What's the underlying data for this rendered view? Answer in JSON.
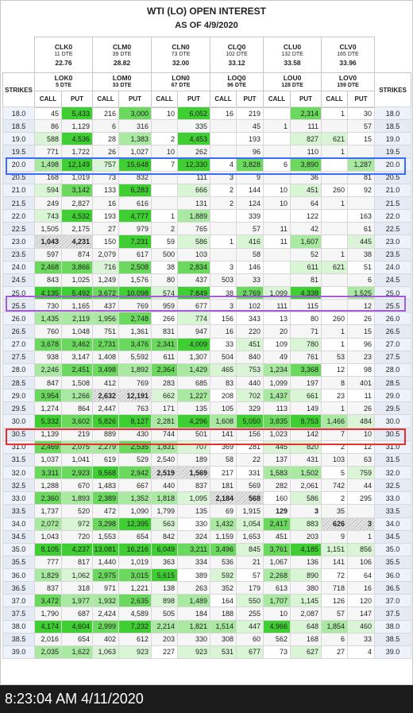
{
  "title": "WTI (LO) OPEN INTEREST",
  "subtitle": "AS OF 4/9/2020",
  "strikes_label": "STRIKES",
  "call_label": "CALL",
  "put_label": "PUT",
  "futures": [
    {
      "name": "CLK0",
      "dte": "11 DTE",
      "price": "22.76"
    },
    {
      "name": "CLM0",
      "dte": "39 DTE",
      "price": "28.82"
    },
    {
      "name": "CLN0",
      "dte": "73 DTE",
      "price": "32.00"
    },
    {
      "name": "CLQ0",
      "dte": "102 DTE",
      "price": "33.12"
    },
    {
      "name": "CLU0",
      "dte": "132 DTE",
      "price": "33.58"
    },
    {
      "name": "CLV0",
      "dte": "165 DTE",
      "price": "33.96"
    }
  ],
  "options": [
    {
      "name": "LOK0",
      "dte": "5 DTE"
    },
    {
      "name": "LOM0",
      "dte": "33 DTE"
    },
    {
      "name": "LON0",
      "dte": "67 DTE"
    },
    {
      "name": "LOQ0",
      "dte": "96 DTE"
    },
    {
      "name": "LOU0",
      "dte": "128 DTE"
    },
    {
      "name": "LOV0",
      "dte": "159 DTE"
    }
  ],
  "rows": [
    [
      "18.0",
      "45",
      "5,433",
      "216",
      "3,000",
      "10",
      "6,052",
      "16",
      "219",
      "",
      "2,314",
      "1",
      "30"
    ],
    [
      "18.5",
      "86",
      "1,129",
      "6",
      "316",
      "",
      "335",
      "",
      "45",
      "1",
      "111",
      "",
      "57"
    ],
    [
      "19.0",
      "588",
      "4,536",
      "28",
      "1,383",
      "2",
      "4,453",
      "",
      "193",
      "",
      "827",
      "621",
      "15"
    ],
    [
      "19.5",
      "771",
      "1,722",
      "26",
      "1,027",
      "10",
      "262",
      "",
      "96",
      "",
      "110",
      "1",
      ""
    ],
    [
      "20.0",
      "1,498",
      "12,149",
      "757",
      "15,648",
      "7",
      "12,330",
      "4",
      "3,828",
      "6",
      "3,890",
      "",
      "1,287"
    ],
    [
      "20.5",
      "168",
      "1,019",
      "73",
      "832",
      "",
      "111",
      "3",
      "9",
      "",
      "36",
      "",
      "81"
    ],
    [
      "21.0",
      "594",
      "3,142",
      "133",
      "6,283",
      "",
      "666",
      "2",
      "144",
      "10",
      "451",
      "260",
      "92"
    ],
    [
      "21.5",
      "249",
      "2,827",
      "16",
      "616",
      "",
      "131",
      "2",
      "124",
      "10",
      "64",
      "1",
      ""
    ],
    [
      "22.0",
      "743",
      "4,532",
      "193",
      "4,777",
      "1",
      "1,889",
      "",
      "339",
      "",
      "122",
      "",
      "163"
    ],
    [
      "22.5",
      "1,505",
      "2,175",
      "27",
      "979",
      "2",
      "765",
      "",
      "57",
      "11",
      "42",
      "",
      "61"
    ],
    [
      "23.0",
      "1,043",
      "4,231",
      "150",
      "7,231",
      "59",
      "586",
      "1",
      "416",
      "11",
      "1,607",
      "",
      "445"
    ],
    [
      "23.5",
      "597",
      "874",
      "2,079",
      "617",
      "500",
      "103",
      "",
      "58",
      "",
      "52",
      "1",
      "38"
    ],
    [
      "24.0",
      "2,468",
      "3,866",
      "716",
      "2,508",
      "38",
      "2,834",
      "3",
      "146",
      "",
      "611",
      "621",
      "51"
    ],
    [
      "24.5",
      "843",
      "1,025",
      "1,249",
      "1,576",
      "80",
      "437",
      "503",
      "33",
      "",
      "81",
      "",
      "6"
    ],
    [
      "25.0",
      "4,135",
      "5,492",
      "3,672",
      "10,098",
      "574",
      "7,849",
      "38",
      "2,769",
      "1,099",
      "4,338",
      "",
      "1,525"
    ],
    [
      "25.5",
      "730",
      "1,165",
      "437",
      "769",
      "959",
      "677",
      "3",
      "102",
      "111",
      "115",
      "",
      "12"
    ],
    [
      "26.0",
      "1,435",
      "2,119",
      "1,956",
      "2,748",
      "266",
      "774",
      "156",
      "343",
      "13",
      "80",
      "260",
      "26"
    ],
    [
      "26.5",
      "760",
      "1,048",
      "751",
      "1,361",
      "831",
      "947",
      "16",
      "220",
      "20",
      "71",
      "1",
      "15"
    ],
    [
      "27.0",
      "3,678",
      "3,462",
      "2,731",
      "3,476",
      "2,341",
      "4,009",
      "33",
      "451",
      "109",
      "780",
      "1",
      "96"
    ],
    [
      "27.5",
      "938",
      "3,147",
      "1,408",
      "5,592",
      "611",
      "1,307",
      "504",
      "840",
      "49",
      "761",
      "53",
      "23"
    ],
    [
      "28.0",
      "2,246",
      "2,451",
      "3,498",
      "1,892",
      "2,364",
      "1,429",
      "465",
      "753",
      "1,234",
      "3,368",
      "12",
      "98"
    ],
    [
      "28.5",
      "847",
      "1,508",
      "412",
      "769",
      "283",
      "685",
      "83",
      "440",
      "1,099",
      "197",
      "8",
      "401"
    ],
    [
      "29.0",
      "3,954",
      "1,266",
      "2,632",
      "12,191",
      "662",
      "1,227",
      "208",
      "702",
      "1,437",
      "661",
      "23",
      "11"
    ],
    [
      "29.5",
      "1,274",
      "864",
      "2,447",
      "763",
      "171",
      "135",
      "105",
      "329",
      "113",
      "149",
      "1",
      "26"
    ],
    [
      "30.0",
      "5,332",
      "3,602",
      "5,826",
      "8,127",
      "2,281",
      "4,296",
      "1,608",
      "5,050",
      "3,835",
      "8,753",
      "1,466",
      "484"
    ],
    [
      "30.5",
      "1,139",
      "219",
      "889",
      "430",
      "744",
      "501",
      "141",
      "156",
      "1,023",
      "142",
      "7",
      "10"
    ],
    [
      "31.0",
      "2,469",
      "2,075",
      "2,279",
      "2,535",
      "1,831",
      "707",
      "369",
      "281",
      "445",
      "820",
      "2",
      "12"
    ],
    [
      "31.5",
      "1,037",
      "1,041",
      "619",
      "529",
      "2,540",
      "189",
      "58",
      "22",
      "137",
      "431",
      "103",
      "63"
    ],
    [
      "32.0",
      "3,311",
      "2,923",
      "9,568",
      "2,942",
      "2,519",
      "1,569",
      "217",
      "331",
      "1,583",
      "1,502",
      "5",
      "759"
    ],
    [
      "32.5",
      "1,288",
      "670",
      "1,483",
      "667",
      "440",
      "837",
      "181",
      "569",
      "282",
      "2,061",
      "742",
      "44"
    ],
    [
      "33.0",
      "2,360",
      "1,893",
      "2,389",
      "1,352",
      "1,818",
      "1,095",
      "2,184",
      "568",
      "160",
      "586",
      "2",
      "295"
    ],
    [
      "33.5",
      "1,737",
      "520",
      "472",
      "1,090",
      "1,799",
      "135",
      "69",
      "1,915",
      "129",
      "3",
      "35",
      ""
    ],
    [
      "34.0",
      "2,072",
      "972",
      "3,298",
      "12,395",
      "563",
      "330",
      "1,432",
      "1,054",
      "2,417",
      "883",
      "626",
      "3"
    ],
    [
      "34.5",
      "1,043",
      "720",
      "1,553",
      "654",
      "842",
      "324",
      "1,159",
      "1,653",
      "451",
      "203",
      "9",
      "1"
    ],
    [
      "35.0",
      "8,105",
      "4,237",
      "13,081",
      "16,216",
      "6,049",
      "3,211",
      "3,496",
      "845",
      "3,761",
      "4,185",
      "1,151",
      "856"
    ],
    [
      "35.5",
      "777",
      "817",
      "1,440",
      "1,019",
      "363",
      "334",
      "536",
      "21",
      "1,067",
      "136",
      "141",
      "106"
    ],
    [
      "36.0",
      "1,829",
      "1,062",
      "2,975",
      "3,015",
      "5,615",
      "389",
      "592",
      "57",
      "2,268",
      "890",
      "72",
      "64"
    ],
    [
      "36.5",
      "837",
      "318",
      "971",
      "1,221",
      "138",
      "263",
      "352",
      "179",
      "613",
      "380",
      "718",
      "16"
    ],
    [
      "37.0",
      "3,472",
      "1,977",
      "1,932",
      "2,635",
      "898",
      "1,489",
      "164",
      "550",
      "1,707",
      "1,145",
      "126",
      "120"
    ],
    [
      "37.5",
      "1,790",
      "687",
      "2,424",
      "4,589",
      "505",
      "184",
      "188",
      "255",
      "10",
      "2,087",
      "57",
      "147"
    ],
    [
      "38.0",
      "4,174",
      "4,604",
      "2,999",
      "7,232",
      "2,214",
      "1,821",
      "1,514",
      "447",
      "4,966",
      "648",
      "1,854",
      "460"
    ],
    [
      "38.5",
      "2,016",
      "654",
      "402",
      "612",
      "203",
      "330",
      "308",
      "60",
      "562",
      "168",
      "6",
      "33"
    ],
    [
      "39.0",
      "2,035",
      "1,622",
      "1,063",
      "923",
      "227",
      "923",
      "531",
      "677",
      "73",
      "627",
      "27",
      "4"
    ]
  ],
  "status_time": "8:23:04 AM 4/11/2020"
}
